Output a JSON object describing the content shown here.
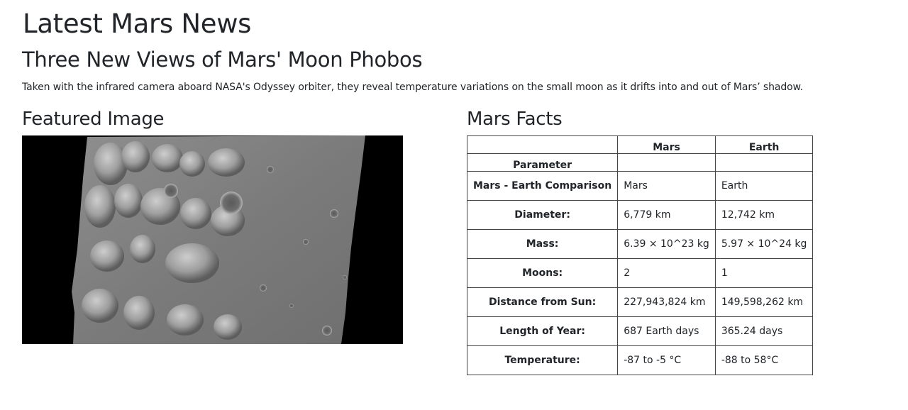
{
  "news": {
    "page_title": "Latest Mars News",
    "headline": "Three New Views of Mars' Moon Phobos",
    "teaser": "Taken with the infrared camera aboard NASA's Odyssey orbiter, they reveal temperature variations on the small moon as it drifts into and out of Mars’ shadow."
  },
  "featured": {
    "heading": "Featured Image",
    "image_description_icon": "mars-surface-image"
  },
  "facts": {
    "heading": "Mars Facts",
    "columns": [
      "",
      "Mars",
      "Earth"
    ],
    "parameter_label": "Parameter",
    "rows": [
      {
        "label": "Mars - Earth Comparison",
        "mars": "Mars",
        "earth": "Earth"
      },
      {
        "label": "Diameter:",
        "mars": "6,779 km",
        "earth": "12,742 km"
      },
      {
        "label": "Mass:",
        "mars": "6.39 × 10^23 kg",
        "earth": "5.97 × 10^24 kg"
      },
      {
        "label": "Moons:",
        "mars": "2",
        "earth": "1"
      },
      {
        "label": "Distance from Sun:",
        "mars": "227,943,824 km",
        "earth": "149,598,262 km"
      },
      {
        "label": "Length of Year:",
        "mars": "687 Earth days",
        "earth": "365.24 days"
      },
      {
        "label": "Temperature:",
        "mars": "-87 to -5 °C",
        "earth": "-88 to 58°C"
      }
    ]
  }
}
